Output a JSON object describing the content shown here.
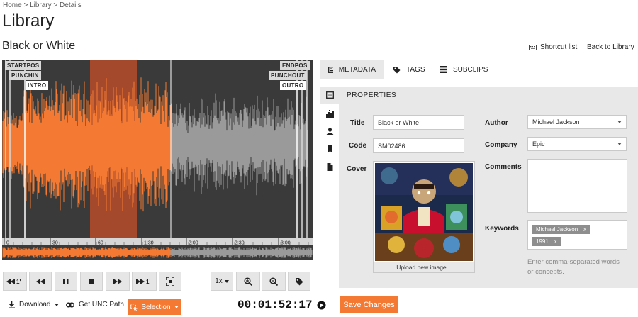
{
  "breadcrumb": "Home > Library > Details",
  "page_title": "Library",
  "track_title": "Black or White",
  "links": {
    "shortcut": "Shortcut list",
    "back": "Back to Library"
  },
  "waveform": {
    "markers": {
      "startpos": "STARTPOS",
      "punchin": "PUNCHIN",
      "intro": "INTRO",
      "endpos": "ENDPOS",
      "punchout": "PUNCHOUT",
      "outro": "OUTRO"
    },
    "time_labels": [
      "0",
      "30",
      "60",
      "1:30",
      "2:00",
      "2:30",
      "3:00"
    ],
    "colors": {
      "played": "#f47a33",
      "unplayed": "#9a9a9a",
      "selection": "#a5492c",
      "background": "#3a3a3a"
    }
  },
  "transport": {
    "speed": "1x"
  },
  "bottom": {
    "download": "Download",
    "unc": "Get UNC Path",
    "selection": "Selection",
    "timecode": "00:01:52:17"
  },
  "tabs": [
    {
      "label": "METADATA"
    },
    {
      "label": "TAGS"
    },
    {
      "label": "SUBCLIPS"
    }
  ],
  "properties": {
    "header": "PROPERTIES",
    "title_label": "Title",
    "title_value": "Black or White",
    "code_label": "Code",
    "code_value": "SM02486",
    "cover_label": "Cover",
    "upload_label": "Upload new image...",
    "author_label": "Author",
    "author_value": "Michael Jackson",
    "company_label": "Company",
    "company_value": "Epic",
    "comments_label": "Comments",
    "comments_value": "",
    "keywords_label": "Keywords",
    "keywords": [
      "Michael Jackson",
      "1991"
    ],
    "keywords_hint": "Enter comma-separated words or concepts.",
    "save_label": "Save Changes"
  },
  "accent": "#f47a33"
}
